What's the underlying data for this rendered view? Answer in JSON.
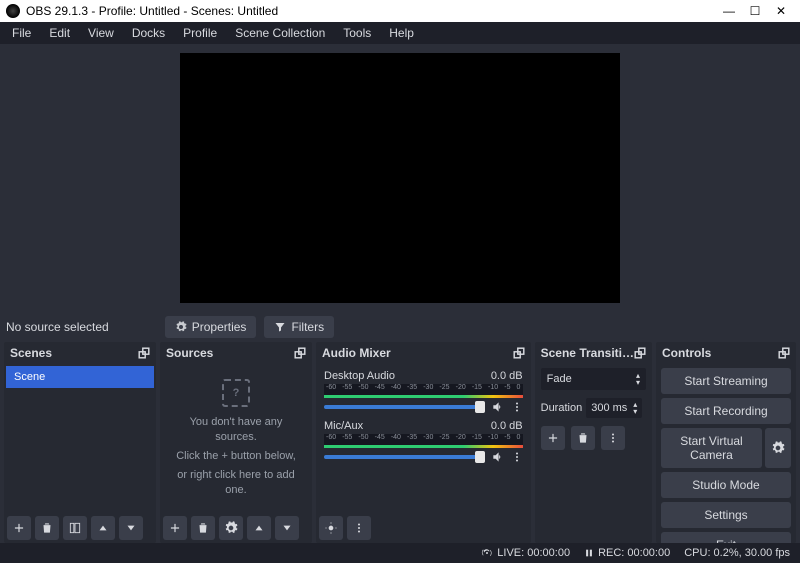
{
  "window": {
    "title": "OBS 29.1.3 - Profile: Untitled - Scenes: Untitled"
  },
  "menu": {
    "items": [
      "File",
      "Edit",
      "View",
      "Docks",
      "Profile",
      "Scene Collection",
      "Tools",
      "Help"
    ]
  },
  "source_toolbar": {
    "no_source": "No source selected",
    "properties": "Properties",
    "filters": "Filters"
  },
  "docks": {
    "scenes": {
      "title": "Scenes",
      "items": [
        "Scene"
      ]
    },
    "sources": {
      "title": "Sources",
      "empty_line1": "You don't have any sources.",
      "empty_line2": "Click the + button below,",
      "empty_line3": "or right click here to add one."
    },
    "mixer": {
      "title": "Audio Mixer",
      "ticks": [
        "-60",
        "-55",
        "-50",
        "-45",
        "-40",
        "-35",
        "-30",
        "-25",
        "-20",
        "-15",
        "-10",
        "-5",
        "0"
      ],
      "channels": [
        {
          "name": "Desktop Audio",
          "level": "0.0 dB"
        },
        {
          "name": "Mic/Aux",
          "level": "0.0 dB"
        }
      ]
    },
    "transitions": {
      "title": "Scene Transiti…",
      "current": "Fade",
      "duration_label": "Duration",
      "duration_value": "300 ms"
    },
    "controls": {
      "title": "Controls",
      "start_streaming": "Start Streaming",
      "start_recording": "Start Recording",
      "start_virtual_camera": "Start Virtual Camera",
      "studio_mode": "Studio Mode",
      "settings": "Settings",
      "exit": "Exit"
    }
  },
  "status": {
    "live": "LIVE: 00:00:00",
    "rec": "REC: 00:00:00",
    "cpu": "CPU: 0.2%, 30.00 fps"
  }
}
